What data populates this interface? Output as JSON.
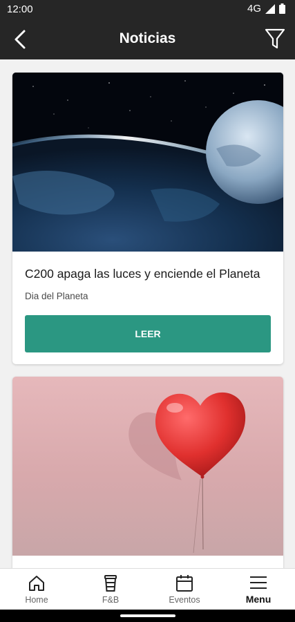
{
  "status_bar": {
    "time": "12:00",
    "network": "4G"
  },
  "app_bar": {
    "title": "Noticias"
  },
  "news": [
    {
      "title": "C200 apaga las luces y enciende el Planeta",
      "subtitle": "Dia del Planeta",
      "button_label": "LEER",
      "image": "earth-from-space-image"
    },
    {
      "image": "red-heart-balloon-image"
    }
  ],
  "bottom_nav": [
    {
      "label": "Home",
      "icon": "home-icon"
    },
    {
      "label": "F&B",
      "icon": "cup-icon"
    },
    {
      "label": "Eventos",
      "icon": "calendar-icon"
    },
    {
      "label": "Menu",
      "icon": "menu-icon",
      "active": true
    }
  ],
  "colors": {
    "accent": "#2b9782",
    "app_bar": "#262626"
  }
}
